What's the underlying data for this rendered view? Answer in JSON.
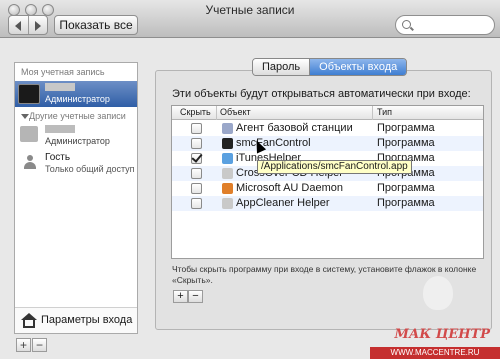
{
  "window": {
    "title": "Учетные записи"
  },
  "toolbar": {
    "show_all_label": "Показать все"
  },
  "sidebar": {
    "my_account_header": "Моя учетная запись",
    "current_user_role": "Администратор",
    "other_accounts_header": "Другие учетные записи",
    "other_user_role": "Администратор",
    "guest_name": "Гость",
    "guest_desc": "Только общий доступ",
    "login_options_label": "Параметры входа"
  },
  "tabs": [
    {
      "label": "Пароль",
      "active": false
    },
    {
      "label": "Объекты входа",
      "active": true
    }
  ],
  "main": {
    "heading": "Эти объекты будут открываться автоматически при входе:",
    "columns": {
      "hide": "Скрыть",
      "object": "Объект",
      "type": "Тип"
    },
    "rows": [
      {
        "checked": false,
        "object": "Агент базовой станции",
        "type": "Программа",
        "icon": "gear-icon",
        "icon_color": "#9aa7c9"
      },
      {
        "checked": false,
        "object": "smcFanControl",
        "type": "Программа",
        "icon": "fan-icon",
        "icon_color": "#222222"
      },
      {
        "checked": true,
        "object": "iTunesHelper",
        "type": "Программа",
        "icon": "itunes-icon",
        "icon_color": "#5aa0e0"
      },
      {
        "checked": false,
        "object": "CrossOver CD Helper",
        "type": "Программа",
        "icon": "app-icon",
        "icon_color": "#c9c9c9"
      },
      {
        "checked": false,
        "object": "Microsoft AU Daemon",
        "type": "Программа",
        "icon": "microsoft-icon",
        "icon_color": "#e07f2a"
      },
      {
        "checked": false,
        "object": "AppCleaner Helper",
        "type": "Программа",
        "icon": "app-icon",
        "icon_color": "#c9c9c9"
      }
    ],
    "tooltip": "/Applications/smcFanControl.app",
    "hint": "Чтобы скрыть программу при входе в систему, установите флажок в колонке «Скрыть».",
    "add_label": "+",
    "remove_label": "−"
  },
  "footer": {
    "add_label": "+",
    "remove_label": "−"
  },
  "watermark": {
    "brand": "МАК ЦЕНТР",
    "url": "WWW.MACCENTRE.RU"
  }
}
